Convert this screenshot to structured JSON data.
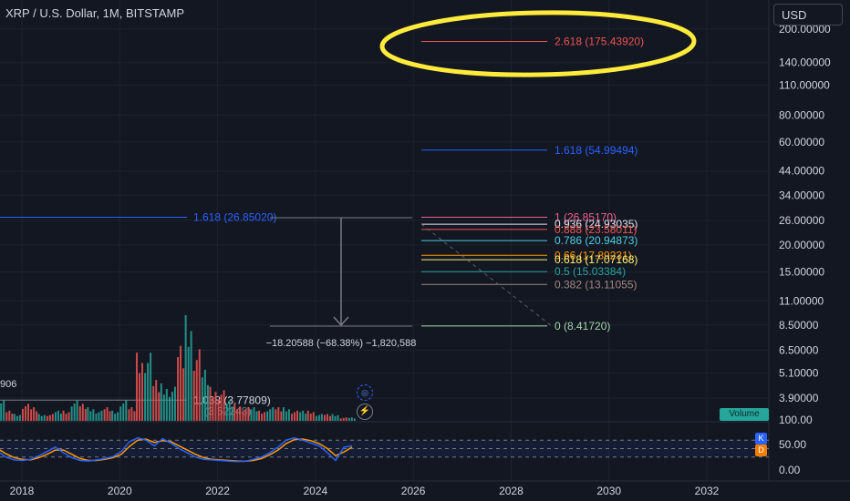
{
  "header": {
    "symbol_title": "XRP / U.S. Dollar, 1M, BITSTAMP",
    "currency_button": "USD"
  },
  "badges": {
    "volume": "Volume",
    "stoch_k": "K",
    "stoch_d": "D",
    "left_value": "906"
  },
  "icons": [
    "crosshair-target-icon",
    "lightning-icon"
  ],
  "colors": {
    "background": "#131722",
    "up": "#26a69a",
    "down": "#ef5350",
    "stoch_k": "#2962ff",
    "stoch_d": "#ff9800",
    "highlight_circle": "#ffeb3b"
  },
  "measurement_label": "−18.20588 (−68.38%) −1,820,588",
  "chart_data": {
    "type": "candlestick",
    "title": "XRP / U.S. Dollar, 1M, BITSTAMP",
    "y_scale": "log",
    "price_axis_ticks": [
      "200.00000",
      "140.00000",
      "110.00000",
      "80.00000",
      "60.00000",
      "44.00000",
      "34.00000",
      "26.00000",
      "20.00000",
      "15.00000",
      "11.00000",
      "8.50000",
      "6.50000",
      "5.10000",
      "3.90000"
    ],
    "x_axis_ticks": [
      "2018",
      "2020",
      "2022",
      "2024",
      "2026",
      "2028",
      "2030",
      "2032"
    ],
    "fib_levels": [
      {
        "label": "2.618 (175.43920)",
        "value": 175.4392,
        "color": "#ef5350",
        "circled": true
      },
      {
        "label": "1.618 (54.99494)",
        "value": 54.99494,
        "color": "#2962ff"
      },
      {
        "label": "1 (26.85170)",
        "value": 26.8517,
        "color": "#f06292"
      },
      {
        "label": "0.936 (24.93035)",
        "value": 24.93035,
        "color": "#e0e3eb"
      },
      {
        "label": "0.888 (23.58011)",
        "value": 23.58011,
        "color": "#ef5350"
      },
      {
        "label": "0.786 (20.94873)",
        "value": 20.94873,
        "color": "#4dd0e1"
      },
      {
        "label": "0.66 (17.89231)",
        "value": 17.89231,
        "color": "#ff9800"
      },
      {
        "label": "0.618 (17.07168)",
        "value": 17.07168,
        "color": "#fff176"
      },
      {
        "label": "0.5 (15.03384)",
        "value": 15.03384,
        "color": "#26a69a"
      },
      {
        "label": "0.382 (13.11055)",
        "value": 13.11055,
        "color": "#a1887f"
      },
      {
        "label": "0 (8.41720)",
        "value": 8.4172,
        "color": "#a5d6a7"
      }
    ],
    "left_fib_levels": [
      {
        "label": "1.618 (26.85020)",
        "value": 26.8502,
        "color": "#2962ff"
      },
      {
        "label": "1.038 (3.77809)",
        "value": 3.77809,
        "color": "#d1d4dc"
      },
      {
        "label": "(3.52248)",
        "value": 3.52248,
        "color": "#787b86"
      }
    ],
    "measurement": {
      "from": 26.8517,
      "to": 8.4172,
      "label": "−18.20588 (−68.38%) −1,820,588"
    },
    "oscillator_axis_ticks": [
      "100.00",
      "50.00",
      "0.00"
    ],
    "oscillator_bands": [
      80,
      20
    ],
    "volume_bars": {
      "x": [
        2017.0,
        2017.17,
        2017.33,
        2017.5,
        2017.67,
        2017.83,
        2018.0,
        2018.17,
        2018.33,
        2018.5,
        2018.67,
        2018.83,
        2019.0,
        2019.17,
        2019.33,
        2019.5,
        2019.67,
        2019.83,
        2020.0,
        2020.17,
        2020.33,
        2020.5,
        2020.67,
        2020.83,
        2021.0,
        2021.17,
        2021.33,
        2021.5,
        2021.67,
        2021.83,
        2022.0,
        2022.17,
        2022.33,
        2022.5,
        2022.67,
        2022.83,
        2023.0,
        2023.17,
        2023.33,
        2023.5,
        2023.67,
        2023.83,
        2024.0,
        2024.17,
        2024.33,
        2024.5,
        2024.67
      ],
      "values": [
        1,
        3,
        2,
        6,
        3,
        2,
        5,
        4,
        2,
        2,
        3,
        3,
        6,
        5,
        4,
        3,
        4,
        3,
        6,
        4,
        20,
        20,
        12,
        11,
        10,
        22,
        31,
        21,
        15,
        10,
        9,
        6,
        5,
        4,
        4,
        3,
        4,
        4,
        4,
        3,
        3,
        3,
        2,
        2,
        2,
        1,
        1
      ],
      "direction": [
        "u",
        "u",
        "d",
        "u",
        "d",
        "u",
        "d",
        "d",
        "u",
        "d",
        "u",
        "d",
        "u",
        "d",
        "u",
        "u",
        "d",
        "u",
        "u",
        "d",
        "d",
        "u",
        "d",
        "u",
        "u",
        "d",
        "u",
        "d",
        "u",
        "d",
        "d",
        "u",
        "d",
        "d",
        "u",
        "d",
        "u",
        "d",
        "u",
        "d",
        "u",
        "d",
        "u",
        "d",
        "u",
        "d",
        "u"
      ]
    },
    "stoch_k_values": [
      55,
      70,
      60,
      40,
      20,
      10,
      8,
      12,
      25,
      40,
      55,
      35,
      18,
      8,
      6,
      10,
      15,
      22,
      40,
      75,
      88,
      80,
      60,
      85,
      70,
      50,
      35,
      20,
      12,
      10,
      8,
      6,
      4,
      5,
      12,
      20,
      35,
      55,
      80,
      88,
      80,
      70,
      60,
      35,
      8,
      55,
      60
    ],
    "stoch_d_values": [
      50,
      62,
      64,
      50,
      32,
      18,
      12,
      10,
      18,
      30,
      45,
      45,
      30,
      15,
      8,
      8,
      12,
      18,
      30,
      58,
      80,
      84,
      72,
      78,
      75,
      60,
      45,
      30,
      18,
      12,
      10,
      8,
      6,
      5,
      8,
      15,
      28,
      45,
      68,
      82,
      84,
      78,
      68,
      50,
      25,
      38,
      55
    ]
  }
}
